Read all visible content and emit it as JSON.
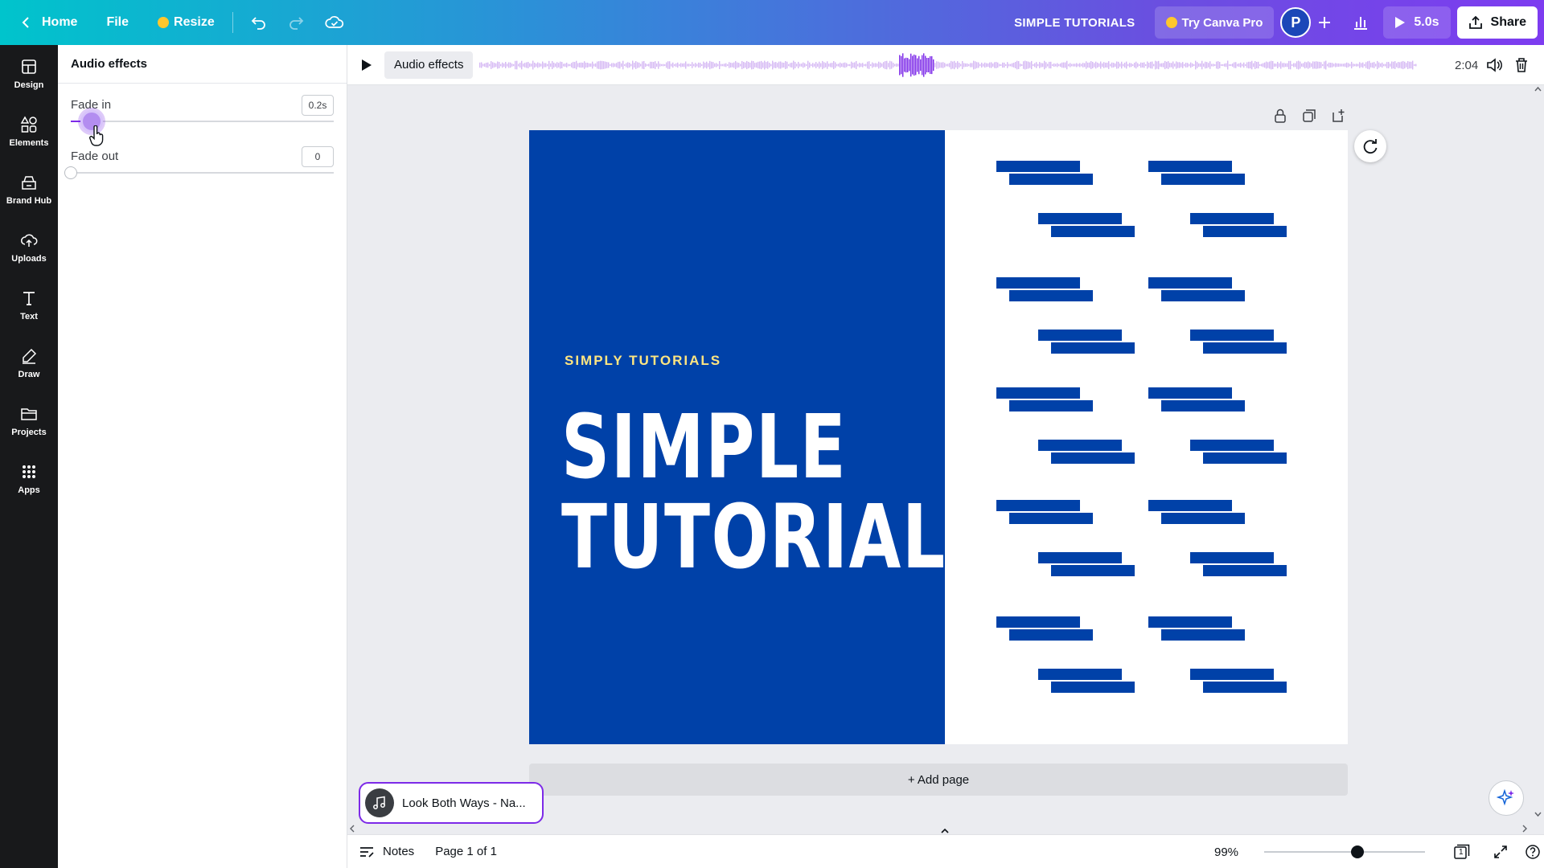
{
  "topbar": {
    "home_label": "Home",
    "file_label": "File",
    "resize_label": "Resize",
    "design_title": "SIMPLE TUTORIALS",
    "pro_label": "Try Canva Pro",
    "avatar_initial": "P",
    "duration_label": "5.0s",
    "share_label": "Share"
  },
  "rail": {
    "items": [
      {
        "label": "Design",
        "icon": "layout-icon"
      },
      {
        "label": "Elements",
        "icon": "shapes-icon"
      },
      {
        "label": "Brand Hub",
        "icon": "brand-icon"
      },
      {
        "label": "Uploads",
        "icon": "cloud-upload-icon"
      },
      {
        "label": "Text",
        "icon": "text-icon"
      },
      {
        "label": "Draw",
        "icon": "pen-icon"
      },
      {
        "label": "Projects",
        "icon": "folder-icon"
      },
      {
        "label": "Apps",
        "icon": "grid-icon"
      }
    ]
  },
  "panel": {
    "title": "Audio effects",
    "fade_in": {
      "label": "Fade in",
      "value": "0.2s",
      "fraction": 0.08
    },
    "fade_out": {
      "label": "Fade out",
      "value": "0",
      "fraction": 0.0
    }
  },
  "audio_strip": {
    "button_label": "Audio effects",
    "time": "2:04"
  },
  "design": {
    "subtitle": "SIMPLY TUTORIALS",
    "headline_line1": "SIMPLE",
    "headline_line2": "TUTORIALS",
    "colors": {
      "blue": "#0041a8",
      "yellow": "#ffe681"
    }
  },
  "canvas": {
    "add_page_label": "+ Add page"
  },
  "music": {
    "track_name": "Look Both Ways - Na..."
  },
  "bottombar": {
    "notes_label": "Notes",
    "page_label": "Page 1 of 1",
    "zoom_label": "99%",
    "zoom_fraction": 0.58,
    "page_count": "1"
  },
  "colors": {
    "accent": "#7d2ae8",
    "rail_bg": "#18191b",
    "canvas_bg": "#ebecf0"
  }
}
